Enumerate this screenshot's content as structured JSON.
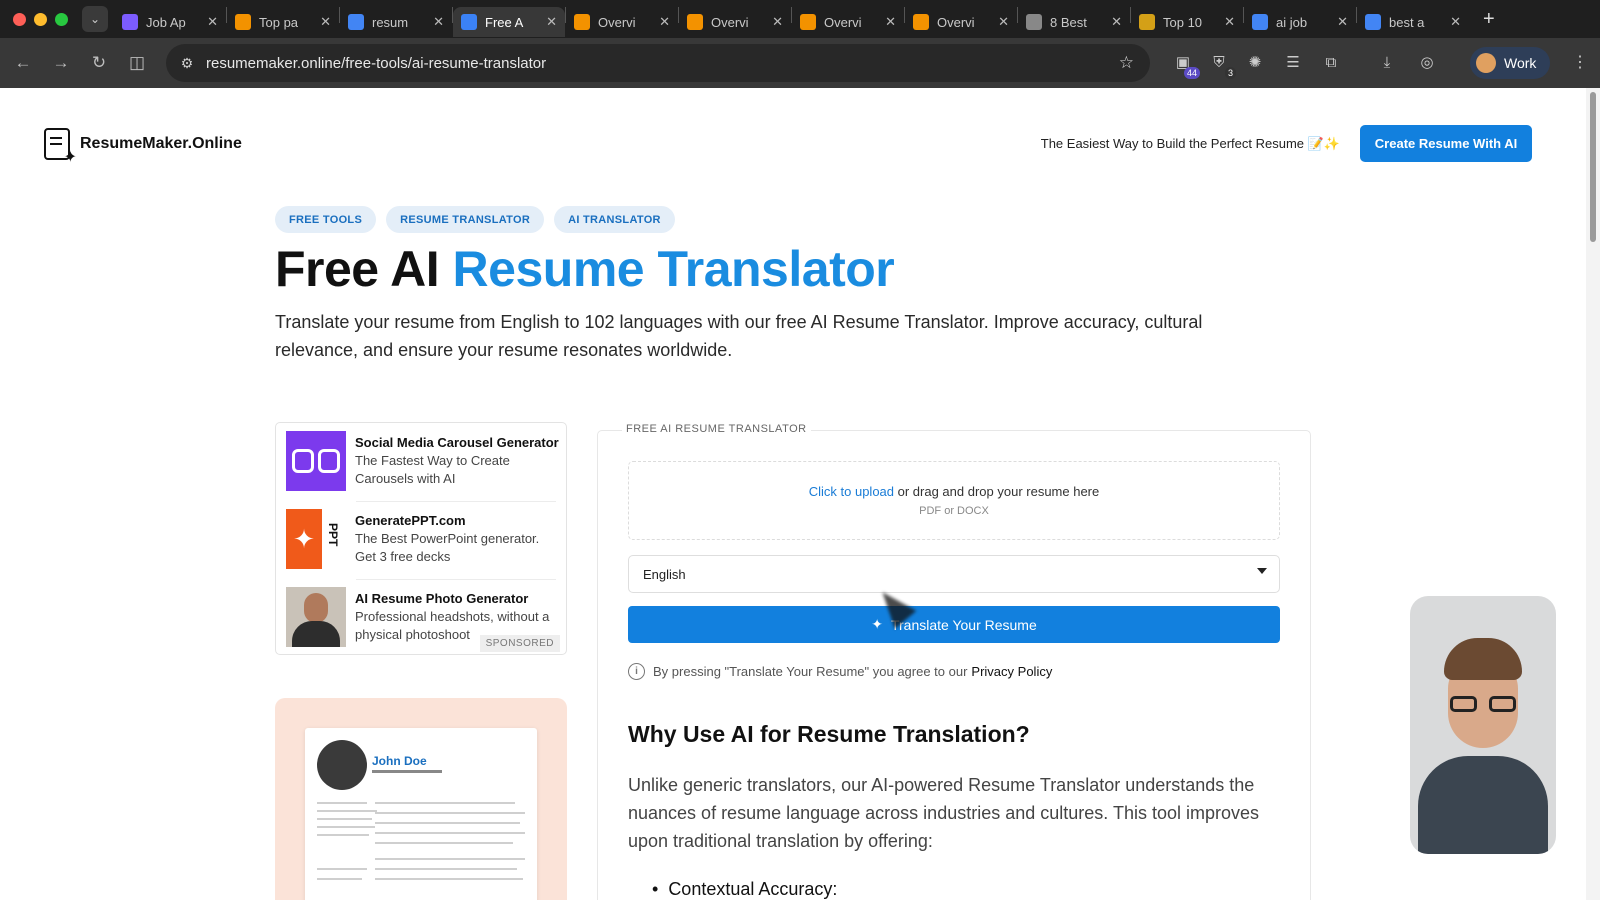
{
  "browser": {
    "tabs": [
      {
        "label": "Job Ap",
        "icon": "wand-icon",
        "color": "#7c5cff",
        "active": false
      },
      {
        "label": "Top pa",
        "icon": "a-icon",
        "color": "#f39200",
        "active": false
      },
      {
        "label": "resum",
        "icon": "google-icon",
        "color": "#4285f4",
        "active": false
      },
      {
        "label": "Free A",
        "icon": "resume-icon",
        "color": "#3b82f6",
        "active": true
      },
      {
        "label": "Overvi",
        "icon": "a-icon",
        "color": "#f39200",
        "active": false
      },
      {
        "label": "Overvi",
        "icon": "a-icon",
        "color": "#f39200",
        "active": false
      },
      {
        "label": "Overvi",
        "icon": "a-icon",
        "color": "#f39200",
        "active": false
      },
      {
        "label": "Overvi",
        "icon": "a-icon",
        "color": "#f39200",
        "active": false
      },
      {
        "label": "8 Best",
        "icon": "smiley-icon",
        "color": "#888888",
        "active": false
      },
      {
        "label": "Top 10",
        "icon": "v-icon",
        "color": "#d4a017",
        "active": false
      },
      {
        "label": "ai job",
        "icon": "google-icon",
        "color": "#4285f4",
        "active": false
      },
      {
        "label": "best a",
        "icon": "google-icon",
        "color": "#4285f4",
        "active": false
      }
    ],
    "url": "resumemaker.online/free-tools/ai-resume-translator",
    "extension_badges": {
      "first": "44",
      "second": "3"
    },
    "profile_label": "Work"
  },
  "site": {
    "logo_text": "ResumeMaker.Online",
    "tagline": "The Easiest Way to Build the Perfect Resume 📝✨",
    "cta_label": "Create Resume With AI"
  },
  "hero": {
    "breadcrumbs": [
      "FREE TOOLS",
      "RESUME TRANSLATOR",
      "AI TRANSLATOR"
    ],
    "title_plain": "Free AI ",
    "title_accent": "Resume Translator",
    "lead": "Translate your resume from English to 102 languages with our free AI Resume Translator. Improve accuracy, cultural relevance, and ensure your resume resonates worldwide."
  },
  "sponsored": {
    "label": "SPONSORED",
    "ads": [
      {
        "title": "Social Media Carousel Generator",
        "desc": "The Fastest Way to Create Carousels with AI"
      },
      {
        "title": "GeneratePPT.com",
        "desc": "The Best PowerPoint generator. Get 3 free decks"
      },
      {
        "title": "AI Resume Photo Generator",
        "desc": "Professional headshots, without a physical photoshoot"
      }
    ]
  },
  "preview": {
    "name": "John Doe"
  },
  "translator": {
    "legend": "FREE AI RESUME TRANSLATOR",
    "upload_link": "Click to upload",
    "upload_rest": " or drag and drop your resume here",
    "upload_formats": "PDF or DOCX",
    "language_selected": "English",
    "button_label": "Translate Your Resume",
    "consent_text": "By pressing \"Translate Your Resume\" you agree to our",
    "privacy_link": "Privacy Policy"
  },
  "article": {
    "heading": "Why Use AI for Resume Translation?",
    "body": "Unlike generic translators, our AI-powered Resume Translator understands the nuances of resume language across industries and cultures. This tool improves upon traditional translation by offering:",
    "bullet_1": "Contextual Accuracy:"
  },
  "colors": {
    "accent": "#1a8ce0",
    "button": "#1280de",
    "chip_bg": "#e4eef8",
    "chip_text": "#1a6fbf"
  }
}
